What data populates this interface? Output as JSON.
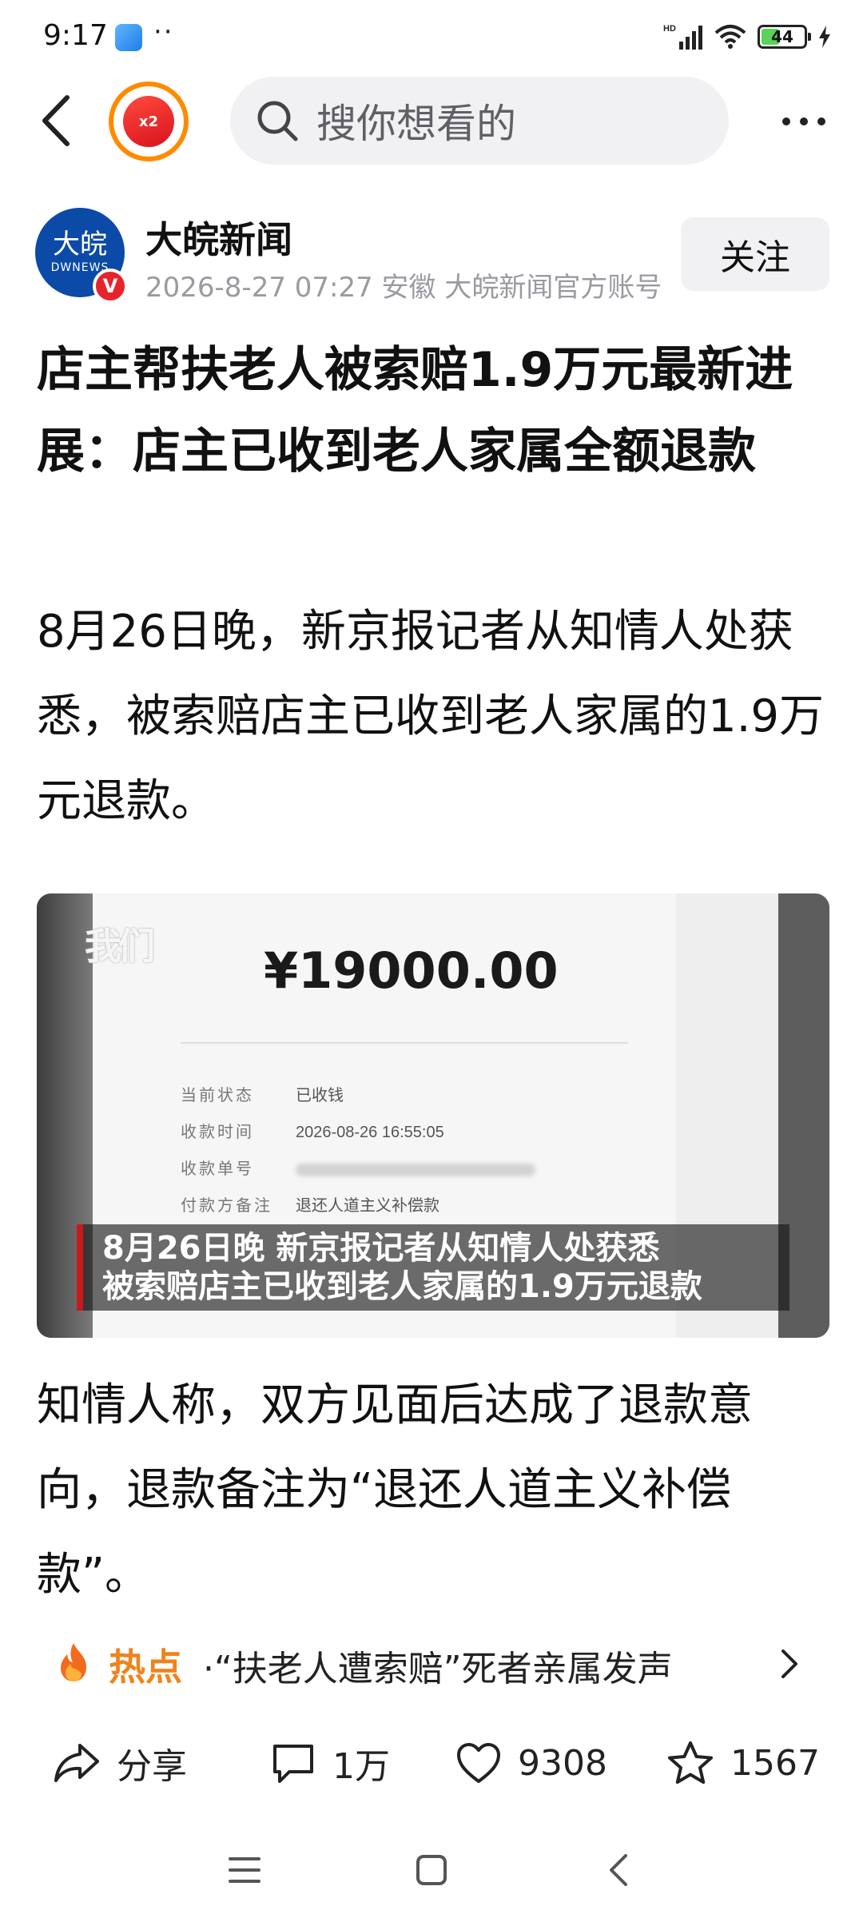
{
  "status_bar": {
    "time": "9:17",
    "dots": "··",
    "hd_label": "HD",
    "battery": "44"
  },
  "top_nav": {
    "promo_badge": "x2",
    "search_placeholder": "搜你想看的"
  },
  "author": {
    "avatar_text": "大皖",
    "avatar_sub": "DWNEWS",
    "verified_mark": "V",
    "name": "大皖新闻",
    "meta": "2026-8-27 07:27 安徽 大皖新闻官方账号",
    "follow_label": "关注"
  },
  "article": {
    "headline": "店主帮扶老人被索赔1.9万元最新进展：店主已收到老人家属全额退款",
    "paragraph1": "8月26日晚，新京报记者从知情人处获悉，被索赔店主已收到老人家属的1.9万元退款。",
    "paragraph2": "知情人称，双方见面后达成了退款意向，退款备注为“退还人道主义补偿款”。"
  },
  "image": {
    "watermark": "我们",
    "amount": "¥19000.00",
    "rows": [
      {
        "label": "当前状态",
        "value": "已收钱"
      },
      {
        "label": "收款时间",
        "value": "2026-08-26 16:55:05"
      },
      {
        "label": "收款单号",
        "value": ""
      },
      {
        "label": "付款方备注",
        "value": "退还人道主义补偿款"
      }
    ],
    "caption_line1": "8月26日晚 新京报记者从知情人处获悉",
    "caption_line2": "被索赔店主已收到老人家属的1.9万元退款"
  },
  "hot_topic": {
    "label": "热点",
    "text": "·“扶老人遭索赔”死者亲属发声"
  },
  "actions": {
    "share": "分享",
    "comments": "1万",
    "likes": "9308",
    "favorites": "1567"
  },
  "icons": {
    "back": "back-arrow-icon",
    "search": "search-icon",
    "more": "more-icon",
    "fire": "fire-icon",
    "share": "share-icon",
    "comment": "comment-icon",
    "like": "heart-icon",
    "favorite": "star-icon"
  },
  "colors": {
    "accent_orange": "#f0831c",
    "verified_red": "#e5242b",
    "brand_blue": "#0c4aa8",
    "caption_red": "#c81a1a"
  }
}
